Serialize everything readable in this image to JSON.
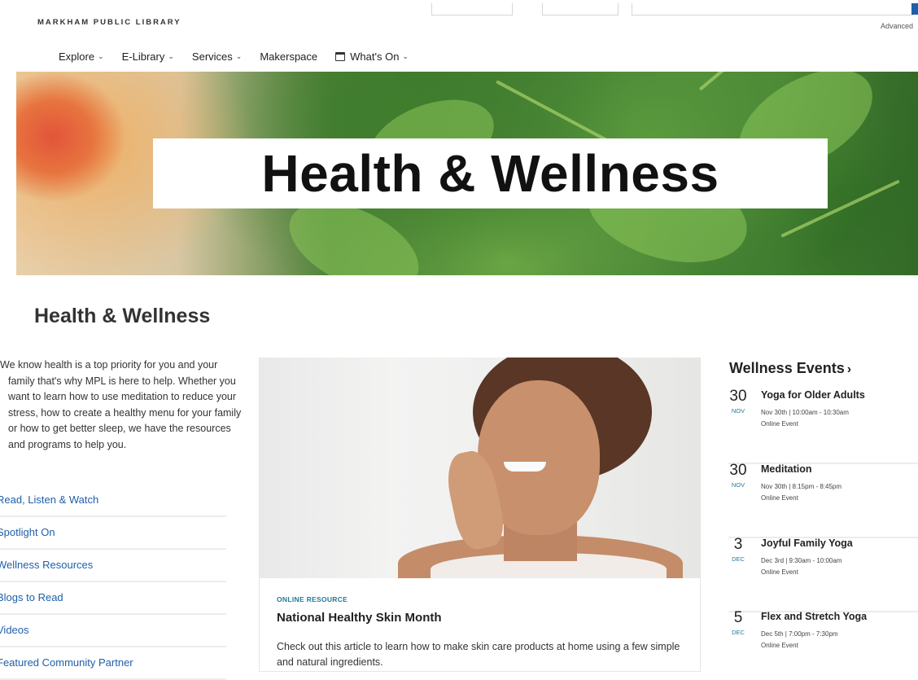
{
  "header": {
    "logo": "MARKHAM PUBLIC LIBRARY",
    "advanced_label": "Advanced"
  },
  "nav": {
    "items": [
      {
        "label": "Explore",
        "has_dropdown": true
      },
      {
        "label": "E-Library",
        "has_dropdown": true
      },
      {
        "label": "Services",
        "has_dropdown": true
      },
      {
        "label": "Makerspace",
        "has_dropdown": false
      },
      {
        "label": "What's On",
        "has_dropdown": true,
        "icon": "calendar-icon"
      }
    ]
  },
  "hero": {
    "banner_text": "Health & Wellness"
  },
  "page": {
    "title": "Health & Wellness",
    "intro": "We know health is a top priority for you and your family that's why MPL is here to help. Whether you want to learn how to use meditation to reduce your stress, how to create a healthy menu for your family or how to get better sleep, we have the resources and programs to help you."
  },
  "sidebar": {
    "links": [
      {
        "label": "Read, Listen & Watch"
      },
      {
        "label": "Spotlight On"
      },
      {
        "label": "Wellness Resources"
      },
      {
        "label": "Blogs to Read"
      },
      {
        "label": "Videos"
      },
      {
        "label": "Featured Community Partner"
      }
    ]
  },
  "feature": {
    "tag": "ONLINE RESOURCE",
    "title": "National Healthy Skin Month",
    "text": "Check out this article to learn how to make skin care products at home using a few simple and natural ingredients."
  },
  "events": {
    "heading": "Wellness Events",
    "arrow": "›",
    "items": [
      {
        "day": "30",
        "month": "NOV",
        "title": "Yoga for Older Adults",
        "time": "Nov 30th | 10:00am - 10:30am",
        "type": "Online Event"
      },
      {
        "day": "30",
        "month": "NOV",
        "title": "Meditation",
        "time": "Nov 30th | 8:15pm - 8:45pm",
        "type": "Online Event"
      },
      {
        "day": "3",
        "month": "DEC",
        "title": "Joyful Family Yoga",
        "time": "Dec 3rd | 9:30am - 10:00am",
        "type": "Online Event"
      },
      {
        "day": "5",
        "month": "DEC",
        "title": "Flex and Stretch Yoga",
        "time": "Dec 5th | 7:00pm - 7:30pm",
        "type": "Online Event"
      }
    ]
  },
  "colors": {
    "link": "#1f5fa8",
    "accent_teal": "#1f7a9c",
    "text": "#222222"
  }
}
